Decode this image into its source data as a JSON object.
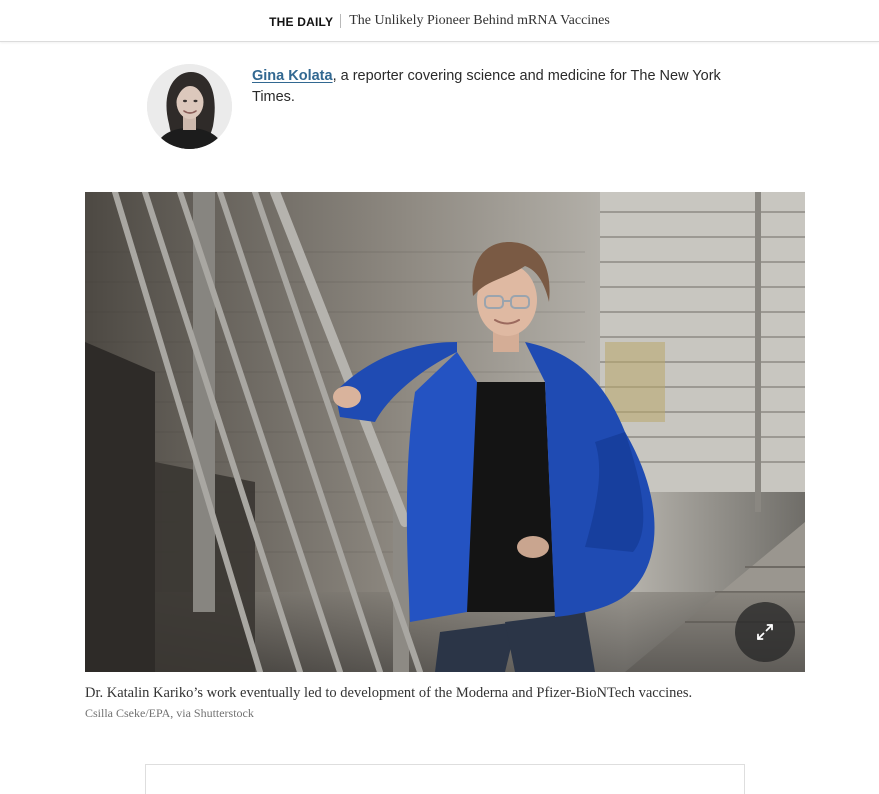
{
  "header": {
    "section": "THE DAILY",
    "headline": "The Unlikely Pioneer Behind mRNA Vaccines"
  },
  "byline": {
    "author": "Gina Kolata",
    "description": ", a reporter covering science and medicine for The New York Times."
  },
  "photo": {
    "caption": "Dr. Katalin Kariko’s work eventually led to development of the Moderna and Pfizer-BioNTech vaccines.",
    "credit": "Csilla Cseke/EPA, via Shutterstock",
    "expand_icon": "expand-arrows-icon"
  },
  "colors": {
    "link": "#326891",
    "text": "#333333",
    "credit": "#727272",
    "jacket": "#1f4bb3"
  }
}
